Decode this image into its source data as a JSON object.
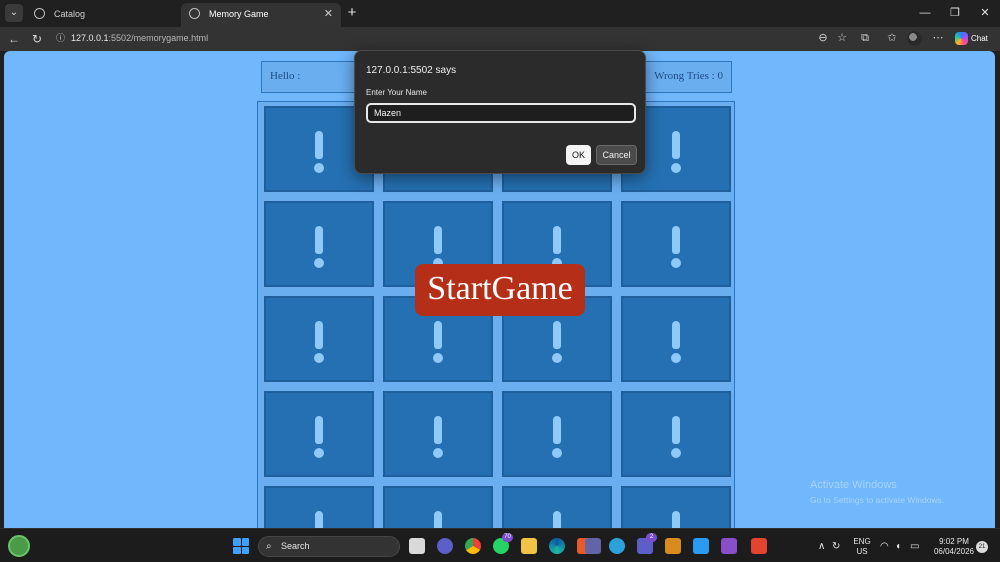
{
  "browser": {
    "tabs": [
      {
        "label": "Catalog",
        "active": false
      },
      {
        "label": "Memory Game",
        "active": true
      }
    ],
    "tab_close_glyph": "✕",
    "new_tab_glyph": "+",
    "window_controls": {
      "minimize": "—",
      "maximize": "❐",
      "close": "✕"
    },
    "url_host": "127.0.0.1",
    "url_path": ":5502/memorygame.html",
    "chat_label": "Chat"
  },
  "game": {
    "hello_label": "Hello :",
    "wrong_tries_label": "Wrong Tries : 0",
    "card_icon": "exclamation-icon",
    "start_button_label": "StartGame",
    "card_color": "#2570b2",
    "background_color": "#70b7fb",
    "start_button_color": "#b52f18"
  },
  "dialog": {
    "title": "127.0.0.1:5502 says",
    "message": "Enter Your Name",
    "input_value": "Mazen",
    "ok_label": "OK",
    "cancel_label": "Cancel"
  },
  "watermark": {
    "title": "Activate Windows",
    "subtitle": "Go to Settings to activate Windows."
  },
  "taskbar": {
    "search_placeholder": "Search",
    "whatsapp_badge": "70",
    "teams_badge": "2",
    "language": "ENG",
    "region": "US",
    "time": "9:02 PM",
    "date": "06/04/2026",
    "notification_count": "21"
  }
}
